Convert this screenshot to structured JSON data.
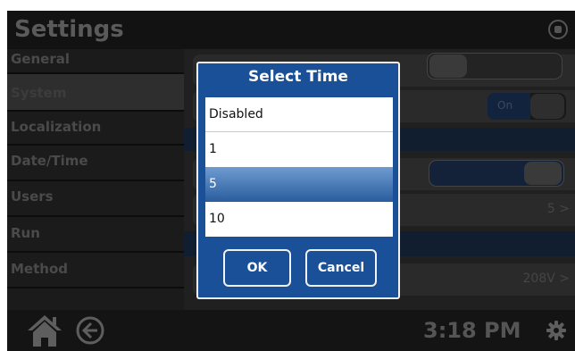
{
  "app": {
    "title": "Settings",
    "time": "3:18 PM"
  },
  "sidebar": {
    "items": [
      {
        "label": "General"
      },
      {
        "label": "System"
      },
      {
        "label": "Localization"
      },
      {
        "label": "Date/Time"
      },
      {
        "label": "Users"
      },
      {
        "label": "Run"
      },
      {
        "label": "Method"
      }
    ]
  },
  "content": {
    "on_label": "On",
    "row_values": [
      "5 >",
      "208V >"
    ]
  },
  "dialog": {
    "title": "Select Time",
    "options": [
      "Disabled",
      "1",
      "5",
      "10"
    ],
    "selected": "5",
    "ok_label": "OK",
    "cancel_label": "Cancel"
  },
  "colors": {
    "dialog_blue": "#1a5098",
    "selection": "#2a5d9e",
    "dark_background": "#161616"
  },
  "icons": {
    "header": "lock-icon",
    "home": "home-icon",
    "back": "back-arrow-icon",
    "settings": "gear-icon"
  }
}
